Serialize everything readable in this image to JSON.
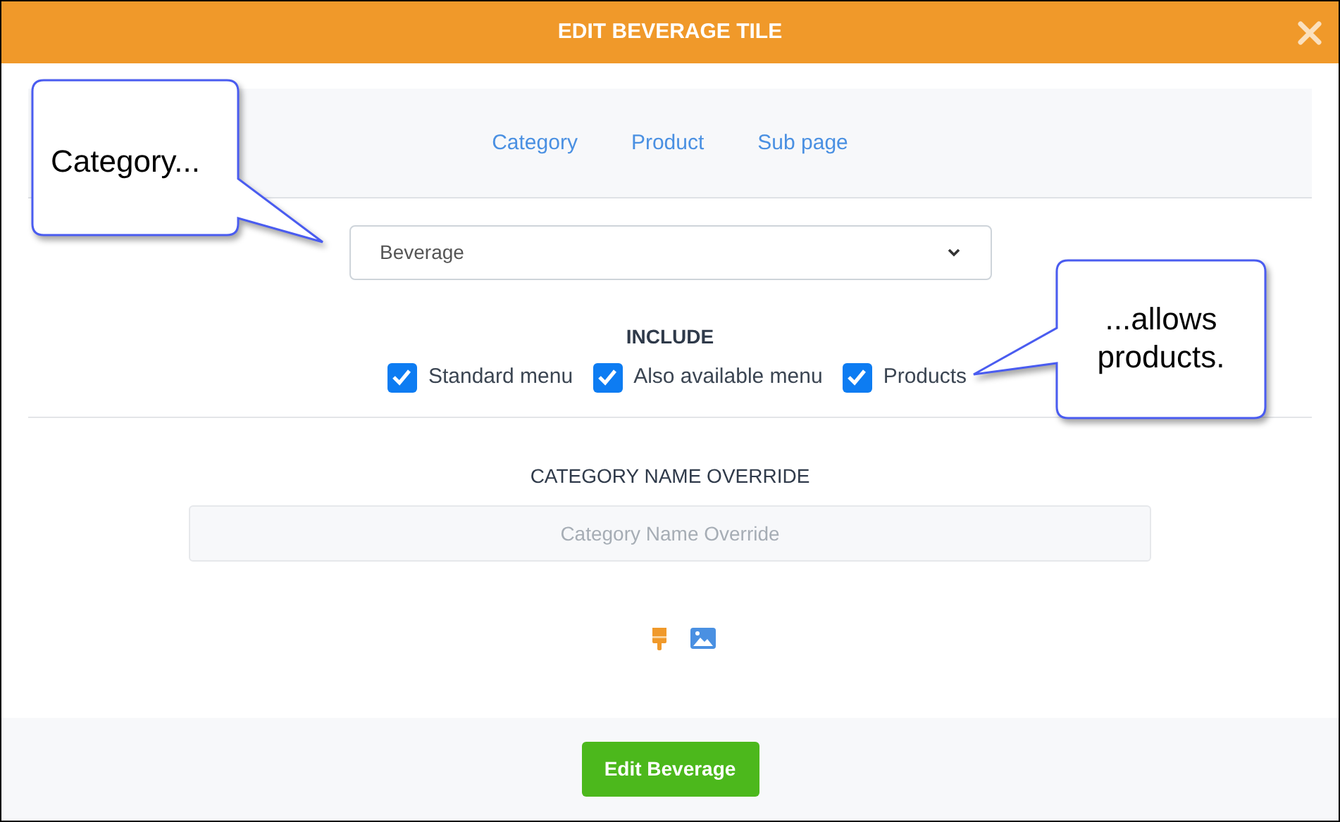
{
  "window": {
    "title": "EDIT BEVERAGE TILE"
  },
  "tabs": [
    {
      "label": "Category"
    },
    {
      "label": "Product"
    },
    {
      "label": "Sub page"
    }
  ],
  "category_select": {
    "value": "Beverage"
  },
  "include": {
    "heading": "INCLUDE",
    "options": [
      {
        "label": "Standard menu",
        "checked": true
      },
      {
        "label": "Also available menu",
        "checked": true
      },
      {
        "label": "Products",
        "checked": true
      }
    ]
  },
  "name_override": {
    "label": "CATEGORY NAME OVERRIDE",
    "placeholder": "Category Name Override"
  },
  "footer": {
    "button": "Edit Beverage"
  },
  "callouts": [
    {
      "text": "Category..."
    },
    {
      "text": "...allows products."
    }
  ]
}
